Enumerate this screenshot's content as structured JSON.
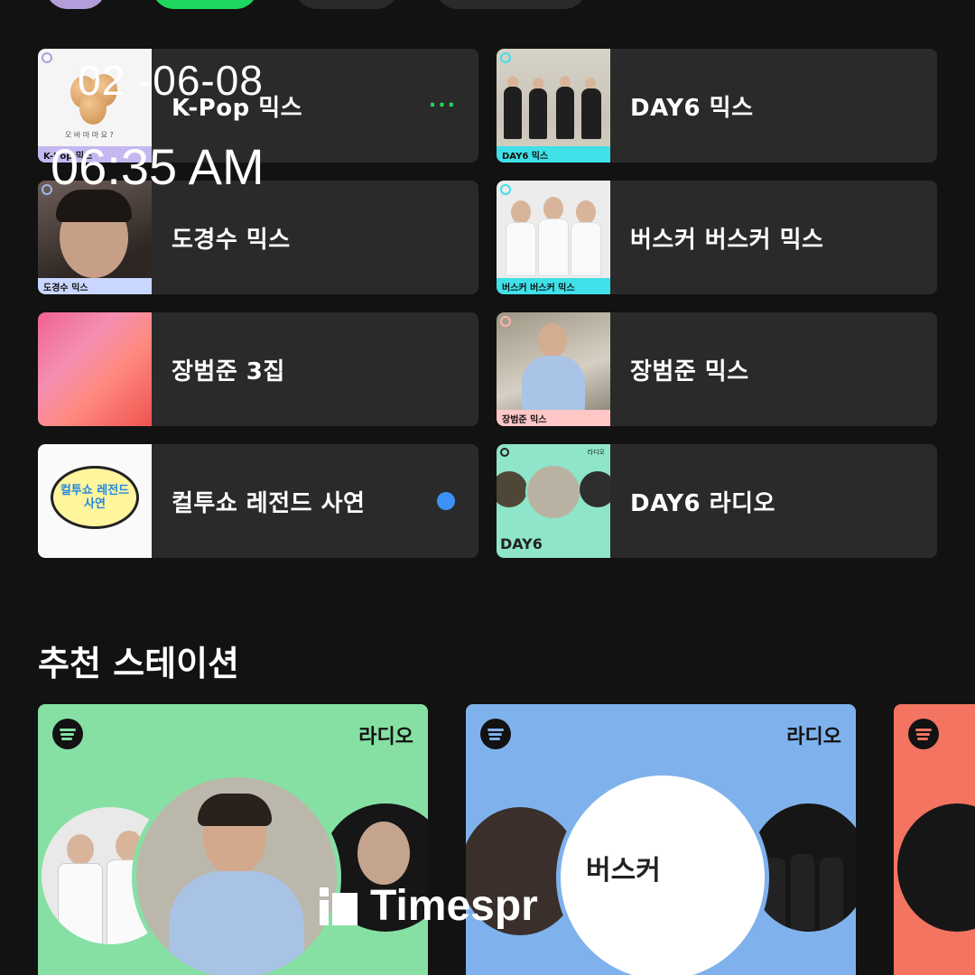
{
  "overlay": {
    "date": "02 -06-08",
    "time": "06:35 AM"
  },
  "shortcuts": [
    {
      "title": "K-Pop 믹스",
      "thumb_caption": "K-Pop 믹스",
      "thumb_text": "오 바 마 마 요 ?",
      "indicator": "more-dots"
    },
    {
      "title": "DAY6 믹스",
      "thumb_caption": "DAY6 믹스"
    },
    {
      "title": "도경수 믹스",
      "thumb_caption": "도경수 믹스"
    },
    {
      "title": "버스커 버스커 믹스",
      "thumb_caption": "버스커 버스커 믹스"
    },
    {
      "title": "장범준 3집"
    },
    {
      "title": "장범준 믹스",
      "thumb_caption": "장범준 믹스"
    },
    {
      "title": "컬투쇼 레전드 사연",
      "thumb_text": "컬투쇼 레전드 사연",
      "indicator": "blue-dot"
    },
    {
      "title": "DAY6 라디오",
      "thumb_caption": "DAY6",
      "thumb_tag": "라디오"
    }
  ],
  "section": {
    "title": "추천 스테이션"
  },
  "stations": [
    {
      "label": "라디오",
      "color": "#86e0a4"
    },
    {
      "label": "라디오",
      "color": "#7fb2ec",
      "center_text": "버스커"
    },
    {
      "label": "",
      "color": "#f27461"
    }
  ],
  "colors": {
    "background": "#121212",
    "tile": "#2a2a2a",
    "accent_green": "#1ed760",
    "dot_blue": "#3d91f4"
  },
  "watermark": {
    "text": "Timespr"
  }
}
